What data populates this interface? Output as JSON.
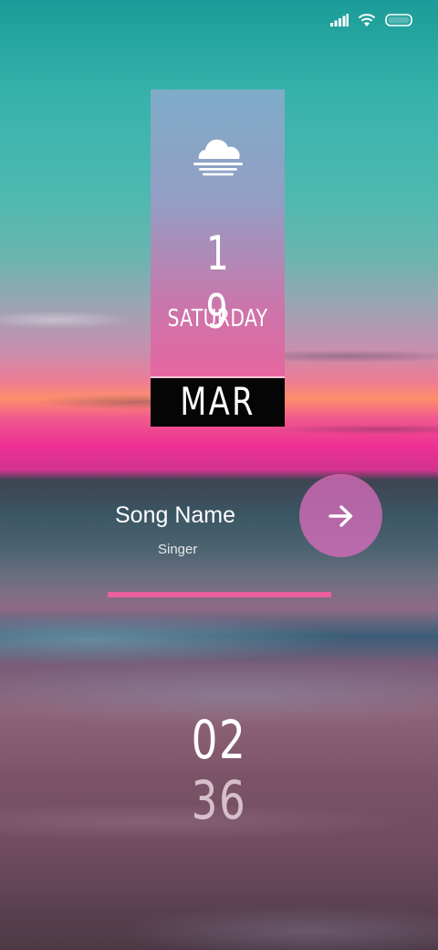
{
  "status_bar": {
    "icons": [
      "signal-icon",
      "wifi-icon",
      "battery-icon"
    ]
  },
  "date_widget": {
    "weather_icon": "cloudy-haze-icon",
    "day": "1 9",
    "weekday": "SATURDAY",
    "month": "MAR"
  },
  "music": {
    "song_name": "Song Name",
    "singer": "Singer",
    "next_icon": "arrow-right-icon",
    "progress": 1.0,
    "progress_color": "#e9609c",
    "button_color": "#dc6ebe"
  },
  "clock": {
    "hour": "02",
    "minute": "36"
  }
}
